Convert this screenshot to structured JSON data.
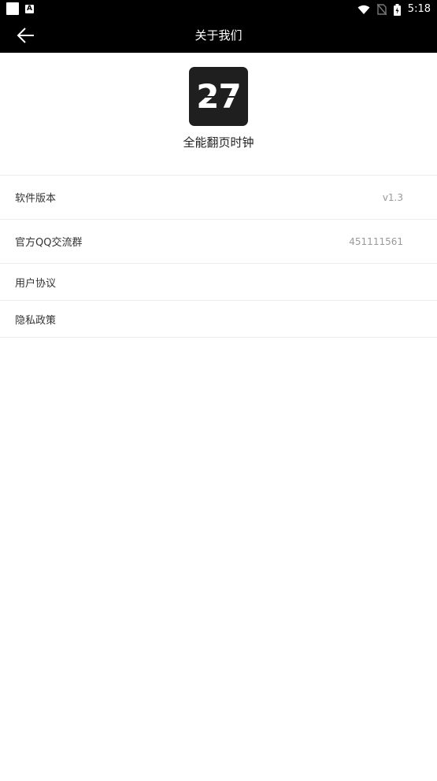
{
  "status_bar": {
    "time": "5:18",
    "notification_badge": "A",
    "icons": [
      "wifi-icon",
      "no-sim-icon",
      "battery-icon"
    ]
  },
  "app_bar": {
    "title": "关于我们",
    "back_icon": "arrow-left-icon"
  },
  "app_info": {
    "logo_text": "27",
    "name": "全能翻页时钟"
  },
  "settings": [
    {
      "label": "软件版本",
      "value": "v1.3"
    },
    {
      "label": "官方QQ交流群",
      "value": "451111561"
    },
    {
      "label": "用户协议",
      "value": ""
    },
    {
      "label": "隐私政策",
      "value": ""
    }
  ],
  "colors": {
    "bar_background": "#000000",
    "page_background": "#ffffff",
    "logo_background": "#1f1f1f",
    "value_text": "#9a9a9a"
  }
}
